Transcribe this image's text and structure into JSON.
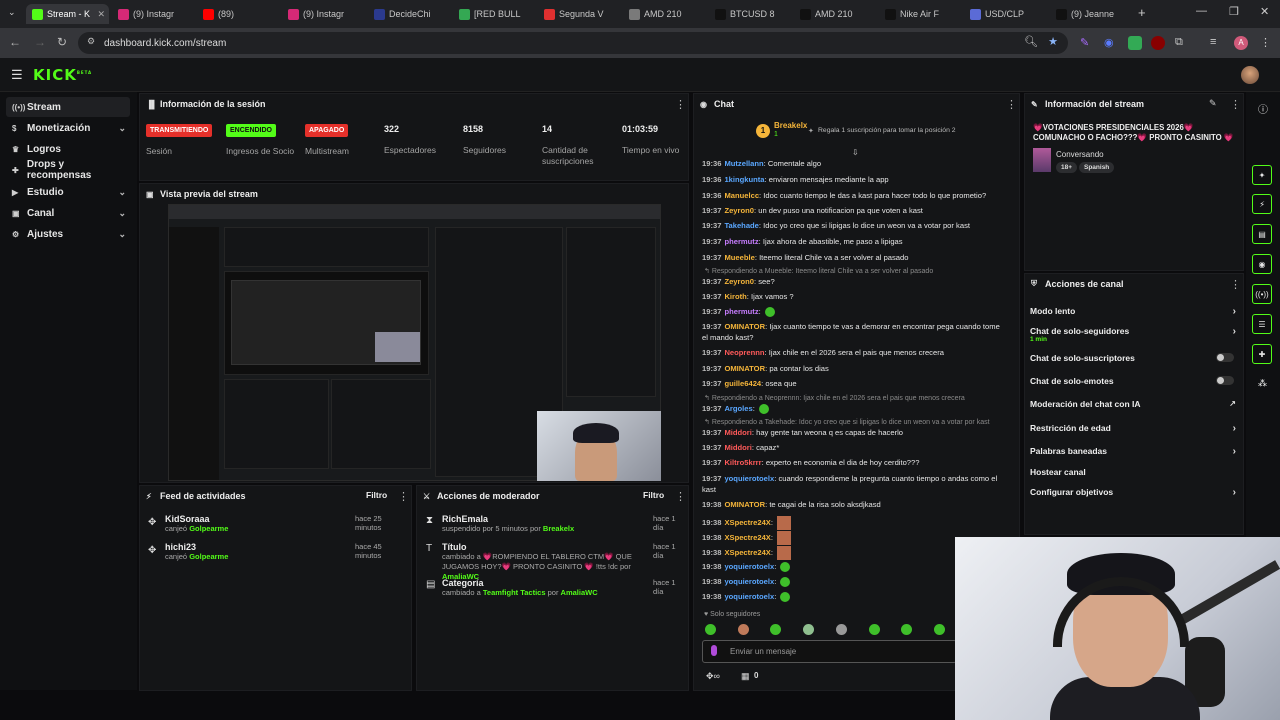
{
  "browser": {
    "tabs": [
      {
        "label": "Stream - K",
        "color": "#53fc18"
      },
      {
        "label": "(9) Instagr",
        "color": "#d62976"
      },
      {
        "label": "(89)",
        "color": "#ff0000"
      },
      {
        "label": "(9) Instagr",
        "color": "#d62976"
      },
      {
        "label": "DecideChi",
        "color": "#2b3a8f"
      },
      {
        "label": "[RED BULL",
        "color": "#34a853"
      },
      {
        "label": "Segunda V",
        "color": "#e03030"
      },
      {
        "label": "AMD 210",
        "color": "#7a7a7a"
      },
      {
        "label": "BTCUSD 8",
        "color": "#111111"
      },
      {
        "label": "AMD 210",
        "color": "#111111"
      },
      {
        "label": "Nike Air F",
        "color": "#111111"
      },
      {
        "label": "USD/CLP",
        "color": "#5b6bd6"
      },
      {
        "label": "(9) Jeanne",
        "color": "#111111"
      }
    ],
    "url": "dashboard.kick.com/stream",
    "profile_initial": "A"
  },
  "app": {
    "logo": "KICK",
    "logo_sup": "BETA"
  },
  "sidebar": {
    "items": [
      {
        "label": "Stream",
        "icon": "stream-icon",
        "chev": ""
      },
      {
        "label": "Monetización",
        "icon": "money-icon",
        "chev": "⌄"
      },
      {
        "label": "Logros",
        "icon": "trophy-icon",
        "chev": ""
      },
      {
        "label": "Drops y recompensas",
        "icon": "gift-icon",
        "chev": ""
      },
      {
        "label": "Estudio",
        "icon": "studio-icon",
        "chev": "⌄"
      },
      {
        "label": "Canal",
        "icon": "channel-icon",
        "chev": "⌄"
      },
      {
        "label": "Ajustes",
        "icon": "settings-icon",
        "chev": "⌄"
      }
    ]
  },
  "session": {
    "title": "Información de la sesión",
    "stats": [
      {
        "badge": "TRANSMITIENDO",
        "badge_color": "#e5302a",
        "label": "Sesión"
      },
      {
        "badge": "ENCENDIDO",
        "badge_color": "#53fc18",
        "label": "Ingresos de Socio"
      },
      {
        "badge": "APAGADO",
        "badge_color": "#e5302a",
        "label": "Multistream"
      },
      {
        "value": "322",
        "label": "Espectadores"
      },
      {
        "value": "8158",
        "label": "Seguidores"
      },
      {
        "value": "14",
        "label": "Cantidad de suscripciones"
      },
      {
        "value": "01:03:59",
        "label": "Tiempo en vivo"
      }
    ]
  },
  "preview": {
    "title": "Vista previa del stream"
  },
  "activity": {
    "title": "Feed de actividades",
    "filter": "Filtro",
    "items": [
      {
        "name": "KidSoraaa",
        "action": "canjeó",
        "reward": "Golpearme",
        "time": "hace 25 minutos"
      },
      {
        "name": "hichi23",
        "action": "canjeó",
        "reward": "Golpearme",
        "time": "hace 45 minutos"
      }
    ]
  },
  "moderator": {
    "title": "Acciones de moderador",
    "filter": "Filtro",
    "items": [
      {
        "name": "RichEmala",
        "detail": "suspendido por 5 minutos por",
        "by": "Breakelx",
        "time": "hace 1 día"
      },
      {
        "name": "Título",
        "detail": "cambiado a 💗ROMPIENDO EL TABLERO CTM💗 QUE JUGAMOS HOY?💗 PRONTO CASINITO 💗 !tts !dc por",
        "by": "AmaliaWC",
        "time": "hace 1 día"
      },
      {
        "name": "Categoría",
        "detail": "cambiado a",
        "extra": "Teamfight Tactics",
        "by": "AmaliaWC",
        "time": "hace 1 día"
      }
    ]
  },
  "chat": {
    "title": "Chat",
    "pinned_user": "Breakelx",
    "pinned_rank": "1",
    "pinned_count": "1",
    "pinned_text": "Regala 1 suscripción para tomar la posición 2",
    "messages": [
      {
        "time": "19:36",
        "user": "Mutzellann",
        "color": "#5aa7ff",
        "text": "Comentale algo"
      },
      {
        "time": "19:36",
        "user": "1kingkunta",
        "color": "#5aa7ff",
        "text": "enviaron mensajes mediante la app"
      },
      {
        "time": "19:36",
        "user": "Manuelcc",
        "color": "#f5b53a",
        "text": "Idoc cuanto tiempo le das a kast para hacer todo lo que prometio?"
      },
      {
        "time": "19:37",
        "user": "Zeyron0",
        "color": "#f5b53a",
        "text": "un dev puso una notificacion pa que voten a kast"
      },
      {
        "time": "19:37",
        "user": "Takehade",
        "color": "#5aa7ff",
        "text": "Idoc yo creo que si lipigas lo dice un weon va a votar por kast"
      },
      {
        "time": "19:37",
        "user": "phermutz",
        "color": "#c77dff",
        "text": "Ijax ahora de abastible, me paso a lipigas"
      },
      {
        "time": "19:37",
        "user": "Mueeble",
        "color": "#f5b53a",
        "text": "Iteemo literal Chile va a ser volver al pasado"
      },
      {
        "reply": "Respondiendo a Mueeble: Iteemo literal Chile va a ser volver al pasado"
      },
      {
        "time": "19:37",
        "user": "Zeyron0",
        "color": "#f5b53a",
        "text": "see?"
      },
      {
        "time": "19:37",
        "user": "Kiroth",
        "color": "#f5b53a",
        "text": "Ijax vamos ?"
      },
      {
        "time": "19:37",
        "user": "phermutz",
        "color": "#c77dff",
        "text": ""
      },
      {
        "time": "19:37",
        "user": "OMINATOR",
        "color": "#f5b53a",
        "text": "Ijax cuanto tiempo te vas a demorar en encontrar pega cuando tome el mando kast?"
      },
      {
        "time": "19:37",
        "user": "Neoprennn",
        "color": "#ff5a5a",
        "text": "Ijax chile en el 2026 sera el pais que menos crecera"
      },
      {
        "time": "19:37",
        "user": "OMINATOR",
        "color": "#f5b53a",
        "text": "pa contar los dias"
      },
      {
        "time": "19:37",
        "user": "guille6424",
        "color": "#f5b53a",
        "text": "osea que"
      },
      {
        "reply": "Respondiendo a Neoprennn: Ijax chile en el 2026 sera el pais que menos crecera"
      },
      {
        "time": "19:37",
        "user": "Argoles",
        "color": "#5aa7ff",
        "text": ""
      },
      {
        "reply": "Respondiendo a Takehade: Idoc yo creo que si lipigas lo dice un weon va a votar por kast"
      },
      {
        "time": "19:37",
        "user": "Middori",
        "color": "#ff5a5a",
        "text": "hay gente tan weona q es capas de hacerlo"
      },
      {
        "time": "19:37",
        "user": "Middori",
        "color": "#ff5a5a",
        "text": "capaz*"
      },
      {
        "time": "19:37",
        "user": "Kiltro5krrr",
        "color": "#ff5a5a",
        "text": "experto en economia el dia de hoy cerdito???"
      },
      {
        "time": "19:37",
        "user": "yoquierotoelx",
        "color": "#5aa7ff",
        "text": "cuando respondieme la pregunta cuanto tiempo o andas como el kast"
      },
      {
        "time": "19:38",
        "user": "OMINATOR",
        "color": "#f5b53a",
        "text": "te cagai de la risa solo aksdjkasd"
      },
      {
        "time": "19:38",
        "user": "XSpectre24X",
        "color": "#f5b53a",
        "text": ""
      },
      {
        "time": "19:38",
        "user": "XSpectre24X",
        "color": "#f5b53a",
        "text": ""
      },
      {
        "time": "19:38",
        "user": "XSpectre24X",
        "color": "#f5b53a",
        "text": ""
      },
      {
        "time": "19:38",
        "user": "yoquierotoelx",
        "color": "#5aa7ff",
        "text": ""
      },
      {
        "time": "19:38",
        "user": "yoquierotoelx",
        "color": "#5aa7ff",
        "text": ""
      },
      {
        "time": "19:38",
        "user": "yoquierotoelx",
        "color": "#5aa7ff",
        "text": ""
      }
    ],
    "followers_only": "Solo seguidores",
    "input_placeholder": "Enviar un mensaje",
    "bottom_count": "0"
  },
  "stream_info": {
    "title": "Información del stream",
    "stream_title": "💗VOTACIONES PRESIDENCIALES 2026💗 COMUNACHO O FACHO???💗 PRONTO CASINITO 💗 ...",
    "category": "Conversando",
    "tags": [
      "18+",
      "Spanish"
    ]
  },
  "channel_actions": {
    "title": "Acciones de canal",
    "items": [
      {
        "label": "Modo lento",
        "sub": "",
        "control": "chev"
      },
      {
        "label": "Chat de solo-seguidores",
        "sub": "1 min",
        "control": "chev"
      },
      {
        "label": "Chat de solo-suscriptores",
        "sub": "",
        "control": "toggle"
      },
      {
        "label": "Chat de solo-emotes",
        "sub": "",
        "control": "toggle"
      },
      {
        "label": "Moderación del chat con IA",
        "sub": "",
        "control": "ext"
      },
      {
        "label": "Restricción de edad",
        "sub": "",
        "control": "chev"
      },
      {
        "label": "Palabras baneadas",
        "sub": "",
        "control": "chev"
      },
      {
        "label": "Hostear canal",
        "sub": "",
        "control": ""
      },
      {
        "label": "Configurar objetivos",
        "sub": "",
        "control": "chev"
      }
    ]
  }
}
